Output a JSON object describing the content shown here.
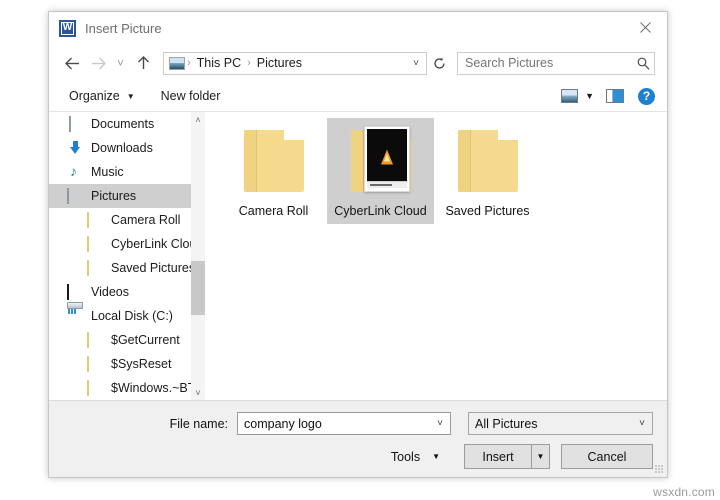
{
  "window": {
    "title": "Insert Picture",
    "app_icon": "word-icon",
    "close_label": "✕"
  },
  "nav": {
    "back_label": "←",
    "forward_label": "→",
    "recent_label": "˅",
    "up_label": "↑",
    "breadcrumb_icon": "pictures-icon",
    "breadcrumb": [
      "This PC",
      "Pictures"
    ],
    "separator": "›",
    "dropdown_label": "˅",
    "refresh_label": "↻"
  },
  "search": {
    "placeholder": "Search Pictures",
    "value": "",
    "icon": "search-icon"
  },
  "commandbar": {
    "organize_label": "Organize",
    "organize_caret": "▼",
    "new_folder_label": "New folder",
    "view_caret": "▼",
    "help_label": "?"
  },
  "sidebar": {
    "items": [
      {
        "label": "Documents",
        "icon": "documents-icon",
        "indent": false,
        "selected": false
      },
      {
        "label": "Downloads",
        "icon": "downloads-icon",
        "indent": false,
        "selected": false
      },
      {
        "label": "Music",
        "icon": "music-icon",
        "indent": false,
        "selected": false
      },
      {
        "label": "Pictures",
        "icon": "pictures-icon",
        "indent": false,
        "selected": true
      },
      {
        "label": "Camera Roll",
        "icon": "folder-icon",
        "indent": true,
        "selected": false
      },
      {
        "label": "CyberLink Clou",
        "icon": "folder-icon",
        "indent": true,
        "selected": false
      },
      {
        "label": "Saved Pictures",
        "icon": "folder-icon",
        "indent": true,
        "selected": false
      },
      {
        "label": "Videos",
        "icon": "videos-icon",
        "indent": false,
        "selected": false
      },
      {
        "label": "Local Disk (C:)",
        "icon": "drive-icon",
        "indent": false,
        "selected": false
      },
      {
        "label": "$GetCurrent",
        "icon": "folder-icon",
        "indent": true,
        "selected": false
      },
      {
        "label": "$SysReset",
        "icon": "folder-icon",
        "indent": true,
        "selected": false
      },
      {
        "label": "$Windows.~BT",
        "icon": "folder-icon",
        "indent": true,
        "selected": false
      }
    ],
    "scroll_up": "˄",
    "scroll_down": "˅"
  },
  "content": {
    "tiles": [
      {
        "label": "Camera Roll",
        "selected": false,
        "thumbnail": false
      },
      {
        "label": "CyberLink Cloud",
        "selected": true,
        "thumbnail": true
      },
      {
        "label": "Saved Pictures",
        "selected": false,
        "thumbnail": false
      }
    ]
  },
  "footer": {
    "filename_label": "File name:",
    "filename_value": "company logo",
    "filename_caret": "˅",
    "filetype_value": "All Pictures",
    "filetype_caret": "˅",
    "tools_label": "Tools",
    "tools_caret": "▼",
    "insert_label": "Insert",
    "insert_caret": "▼",
    "cancel_label": "Cancel"
  },
  "watermark": "wsxdn.com",
  "colors": {
    "accent_blue": "#1f7fd0",
    "word_blue": "#2b579a",
    "selection_grey": "#cfcfcf",
    "folder_yellow": "#f5d98c",
    "footer_grey": "#f0f0f0"
  }
}
